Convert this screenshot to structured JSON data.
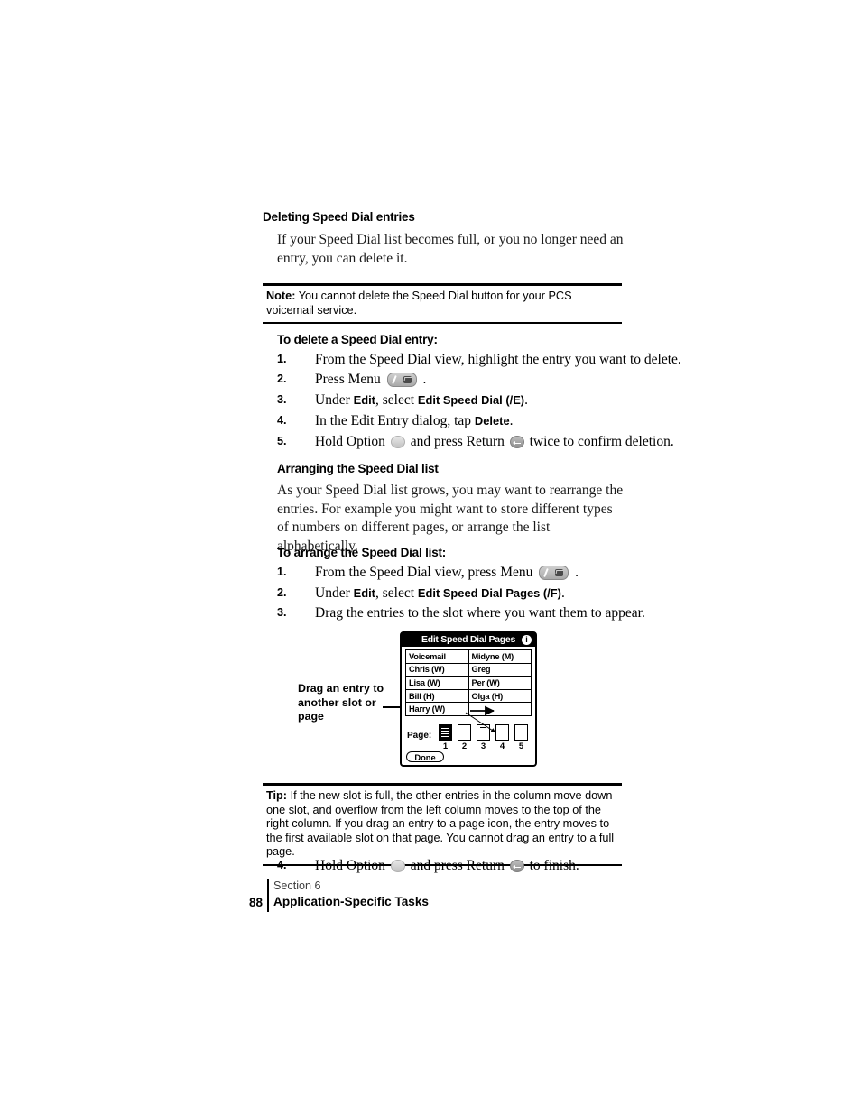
{
  "sections": {
    "deleting": {
      "heading": "Deleting Speed Dial entries",
      "paragraph": "If your Speed Dial list becomes full, or you no longer need an entry, you can delete it."
    },
    "note": {
      "label": "Note:",
      "text": "You cannot delete the Speed Dial button for your PCS voicemail service."
    },
    "delete_proc": {
      "heading": "To delete a Speed Dial entry:",
      "steps": [
        {
          "num": "1.",
          "pre": "From the Speed Dial view, highlight the entry you want to delete.",
          "bold": "",
          "post": ""
        },
        {
          "num": "2.",
          "pre": "Press Menu ",
          "bold": "",
          "post": " .",
          "icon": "menu-key-icon"
        },
        {
          "num": "3.",
          "pre": "Under ",
          "bold": "Edit",
          "mid": ", select ",
          "bold2": "Edit Speed Dial (/E)",
          "post": "."
        },
        {
          "num": "4.",
          "pre": "In the Edit Entry dialog, tap ",
          "bold": "Delete",
          "post": "."
        },
        {
          "num": "5.",
          "pre": "Hold Option ",
          "mid": " and press Return ",
          "post": " twice to confirm deletion.",
          "icon": "option-key-icon",
          "icon2": "return-key-icon"
        }
      ]
    },
    "arranging": {
      "heading": "Arranging the Speed Dial list",
      "paragraph": "As your Speed Dial list grows, you may want to rearrange the entries. For example you might want to store different types of numbers on different pages, or arrange the list alphabetically."
    },
    "arrange_proc": {
      "heading": "To arrange the Speed Dial list:",
      "steps": [
        {
          "num": "1.",
          "pre": "From the Speed Dial view, press Menu ",
          "post": " .",
          "icon": "menu-key-icon"
        },
        {
          "num": "2.",
          "pre": "Under ",
          "bold": "Edit",
          "mid": ", select ",
          "bold2": "Edit Speed Dial Pages (/F)",
          "post": "."
        },
        {
          "num": "3.",
          "pre": "Drag the entries to the slot where you want them to appear.",
          "post": ""
        }
      ]
    },
    "tip": {
      "label": "Tip:",
      "text": "If the new slot is full, the other entries in the column move down one slot, and overflow from the left column moves to the top of the right column. If you drag an entry to a page icon, the entry moves to the first available slot on that page. You cannot drag an entry to a full page."
    },
    "final_step": {
      "num": "4.",
      "pre": "Hold Option ",
      "mid": " and press Return ",
      "post": " to finish."
    }
  },
  "figure": {
    "caption": "Drag an entry to another slot or page",
    "title": "Edit Speed Dial Pages",
    "info_icon": "i",
    "slots": [
      [
        "Voicemail",
        "Midyne (M)"
      ],
      [
        "Chris (W)",
        "Greg"
      ],
      [
        "Lisa (W)",
        "Per (W)"
      ],
      [
        "Bill (H)",
        "Olga (H)"
      ],
      [
        "Harry (W)",
        ""
      ]
    ],
    "page_label": "Page:",
    "pages": [
      "1",
      "2",
      "3",
      "4",
      "5"
    ],
    "selected_page": "1",
    "done_label": "Done"
  },
  "footer": {
    "page_number": "88",
    "section": "Section 6",
    "title": "Application-Specific Tasks"
  },
  "colors": {
    "ink": "#000000",
    "body_text": "#1a1a1a",
    "section_gray": "#3d3d3d",
    "paper": "#ffffff"
  }
}
